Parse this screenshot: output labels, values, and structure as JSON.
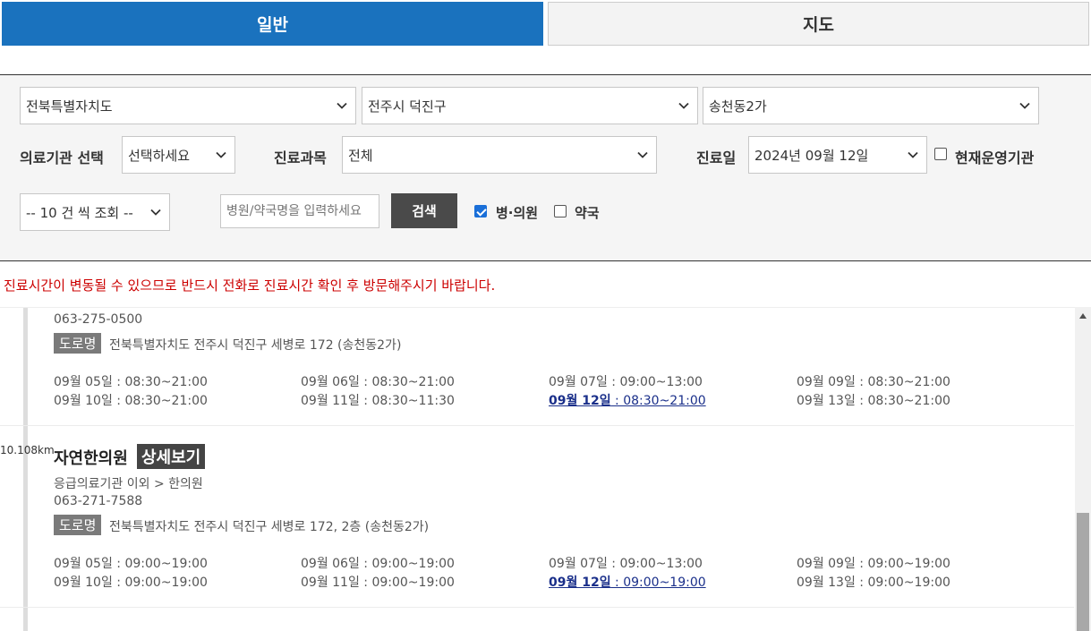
{
  "tabs": [
    {
      "label": "일반",
      "active": true
    },
    {
      "label": "지도",
      "active": false
    }
  ],
  "filters": {
    "region": "전북특별자치도",
    "city": "전주시 덕진구",
    "dong": "송천동2가",
    "institution_label": "의료기관 선택",
    "institution_value": "선택하세요",
    "dept_label": "진료과목",
    "dept_value": "전체",
    "date_label": "진료일",
    "date_value": "2024년 09월 12일",
    "operating_label": "현재운영기관",
    "operating_checked": false,
    "page_size": "-- 10 건 씩 조회 --",
    "search_placeholder": "병원/약국명을 입력하세요",
    "search_button": "검색",
    "hospital_label": "병·의원",
    "hospital_checked": true,
    "pharmacy_label": "약국",
    "pharmacy_checked": false
  },
  "notice": "진료시간이 변동될 수 있으므로 반드시 전화로 진료시간 확인 후 방문해주시기 바랍니다.",
  "results": [
    {
      "phone": "063-275-0500",
      "road_badge": "도로명",
      "address": "전북특별자치도 전주시 덕진구 세병로 172 (송천동2가)",
      "hours": [
        {
          "day": "09월 05일",
          "time": " : 08:30~21:00"
        },
        {
          "day": "09월 06일",
          "time": " : 08:30~21:00"
        },
        {
          "day": "09월 07일",
          "time": " : 09:00~13:00"
        },
        {
          "day": "09월 09일",
          "time": " : 08:30~21:00"
        },
        {
          "day": "09월 10일",
          "time": " : 08:30~21:00"
        },
        {
          "day": "09월 11일",
          "time": " : 08:30~11:30"
        },
        {
          "day": "09월 12일",
          "time": " : 08:30~21:00",
          "today": true
        },
        {
          "day": "09월 13일",
          "time": " : 08:30~21:00"
        }
      ]
    },
    {
      "distance": "10.108km",
      "name": "자연한의원",
      "detail_button": "상세보기",
      "category": "응급의료기관 이외 > 한의원",
      "phone": "063-271-7588",
      "road_badge": "도로명",
      "address": "전북특별자치도 전주시 덕진구 세병로 172, 2층 (송천동2가)",
      "hours": [
        {
          "day": "09월 05일",
          "time": " : 09:00~19:00"
        },
        {
          "day": "09월 06일",
          "time": " : 09:00~19:00"
        },
        {
          "day": "09월 07일",
          "time": " : 09:00~13:00"
        },
        {
          "day": "09월 09일",
          "time": " : 09:00~19:00"
        },
        {
          "day": "09월 10일",
          "time": " : 09:00~19:00"
        },
        {
          "day": "09월 11일",
          "time": " : 09:00~19:00"
        },
        {
          "day": "09월 12일",
          "time": " : 09:00~19:00",
          "today": true
        },
        {
          "day": "09월 13일",
          "time": " : 09:00~19:00"
        }
      ]
    }
  ],
  "icons": {
    "select_arrow": "chevron-down-icon",
    "scroll_up": "triangle-up-icon"
  }
}
